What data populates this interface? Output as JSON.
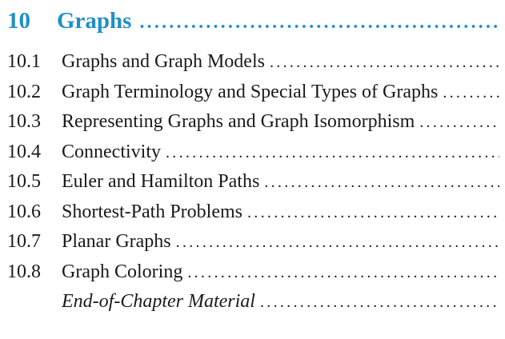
{
  "chapter": {
    "number": "10",
    "title": "Graphs",
    "color": "#1f8fc9"
  },
  "sections": [
    {
      "number": "10.1",
      "title": "Graphs and Graph Models",
      "italic": false
    },
    {
      "number": "10.2",
      "title": "Graph Terminology and Special Types of Graphs",
      "italic": false
    },
    {
      "number": "10.3",
      "title": "Representing Graphs and Graph Isomorphism",
      "italic": false
    },
    {
      "number": "10.4",
      "title": "Connectivity",
      "italic": false
    },
    {
      "number": "10.5",
      "title": "Euler and Hamilton Paths",
      "italic": false
    },
    {
      "number": "10.6",
      "title": "Shortest-Path Problems",
      "italic": false
    },
    {
      "number": "10.7",
      "title": "Planar Graphs",
      "italic": false
    },
    {
      "number": "10.8",
      "title": "Graph Coloring",
      "italic": false
    },
    {
      "number": "",
      "title": "End-of-Chapter Material",
      "italic": true
    }
  ]
}
